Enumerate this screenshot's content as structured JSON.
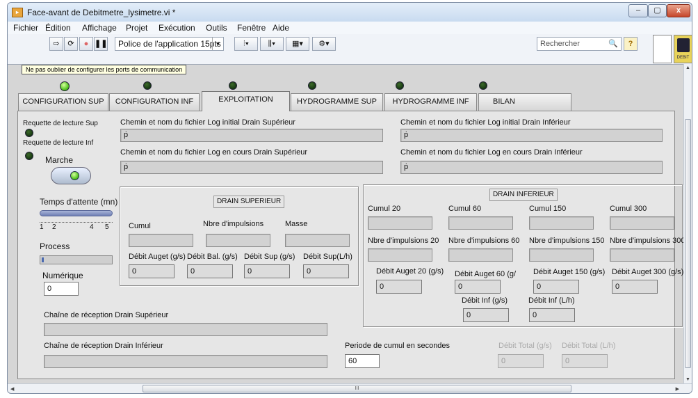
{
  "window": {
    "title": "Face-avant de Debitmetre_lysimetre.vi *",
    "app_icon": "labview-vi-icon",
    "controls": {
      "min": "–",
      "max": "▢",
      "close": "x"
    }
  },
  "menubar": [
    "Fichier",
    "Édition",
    "Affichage",
    "Projet",
    "Exécution",
    "Outils",
    "Fenêtre",
    "Aide"
  ],
  "toolbar": {
    "run_icon": "run-arrow-icon",
    "font_select": "Police de l'application 15pts",
    "search_placeholder": "Rechercher",
    "help": "?",
    "vi_icon_caption": "DEBIT"
  },
  "tooltip": "Ne pas oublier de configurer les ports de communication",
  "tabs": [
    {
      "label": "CONFIGURATION SUP",
      "led": "on"
    },
    {
      "label": "CONFIGURATION INF",
      "led": "off"
    },
    {
      "label": "EXPLOITATION",
      "led": "off",
      "active": true
    },
    {
      "label": "HYDROGRAMME SUP",
      "led": "off"
    },
    {
      "label": "HYDROGRAMME INF",
      "led": "off"
    },
    {
      "label": "BILAN",
      "led": "off"
    }
  ],
  "left": {
    "req_sup": "Requette de lecture Sup",
    "req_inf": "Requette de lecture Inf",
    "marche": "Marche",
    "temps": "Temps d'attente (mn)",
    "slider_value": 5,
    "slider_range": [
      1,
      5
    ],
    "ticks": [
      "1",
      "2",
      "4",
      "5"
    ],
    "process": "Process",
    "process_fraction": 0.02,
    "numerique": "Numérique",
    "numerique_value": "0"
  },
  "paths": {
    "log_init_sup": "Chemin et nom du fichier Log initial Drain Supérieur",
    "log_init_inf": "Chemin et nom du fichier Log initial Drain Inférieur",
    "log_cours_sup": "Chemin et nom du fichier Log en cours Drain Supérieur",
    "log_cours_inf": "Chemin et nom du fichier Log en cours Drain Inférieur",
    "path_symbol": "ṗ"
  },
  "drain_sup": {
    "title": "DRAIN SUPERIEUR",
    "cumul": "Cumul",
    "nbre": "Nbre d'impulsions",
    "masse": "Masse",
    "debit_auget": "Débit Auget (g/s)",
    "debit_bal": "Débit Bal. (g/s)",
    "debit_sup_gs": "Débit Sup (g/s)",
    "debit_sup_lh": "Débit Sup(L/h)",
    "values": [
      "0",
      "0",
      "0",
      "0"
    ]
  },
  "drain_inf": {
    "title": "DRAIN INFERIEUR",
    "cumuls": [
      "Cumul 20",
      "Cumul 60",
      "Cumul 150",
      "Cumul 300"
    ],
    "nbres": [
      "Nbre d'impulsions 20",
      "Nbre d'impulsions 60",
      "Nbre d'impulsions 150",
      "Nbre d'impulsions 300"
    ],
    "debits": [
      "Débit Auget 20 (g/s)",
      "Débit Auget 60 (g/",
      "Débit Auget 150 (g/s)",
      "Débit Auget 300 (g/s)"
    ],
    "debit_values": [
      "0",
      "0",
      "0",
      "0"
    ],
    "debit_inf_gs": "Débit Inf (g/s)",
    "debit_inf_lh": "Débit Inf (L/h)",
    "inf_values": [
      "0",
      "0"
    ]
  },
  "bottom": {
    "chaine_sup": "Chaîne de réception Drain Supérieur",
    "chaine_inf": "Chaîne de réception Drain Inférieur",
    "periode": "Periode de cumul en secondes",
    "periode_value": "60",
    "total_gs": "Débit Total (g/s)",
    "total_lh": "Débit Total (L/h)",
    "total_values": [
      "0",
      "0"
    ]
  },
  "scroll": {
    "grip": "III"
  }
}
